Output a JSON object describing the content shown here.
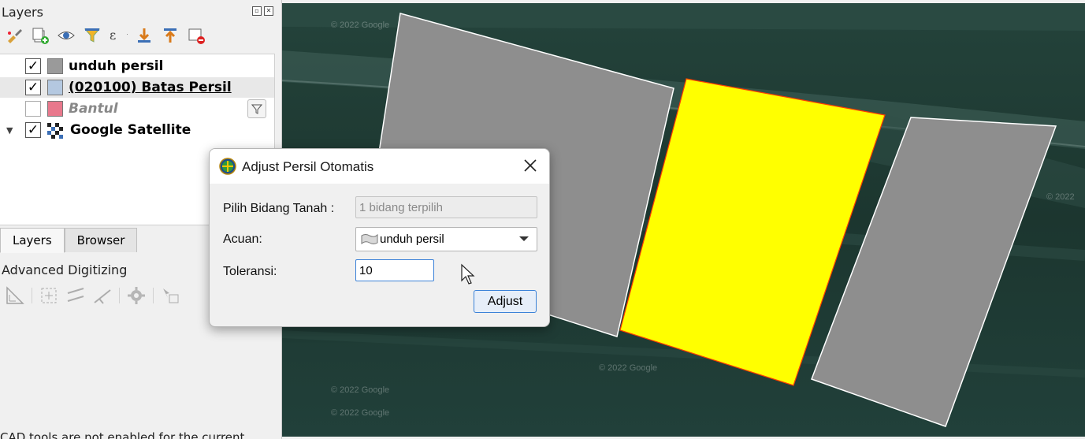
{
  "layers_panel": {
    "title": "Layers",
    "toolbar_icons": [
      "style-brush-icon",
      "add-group-icon",
      "eye-icon",
      "filter-icon",
      "expression-filter-icon",
      "expand-all-icon",
      "collapse-all-icon",
      "remove-layer-icon"
    ],
    "layers": [
      {
        "name": "unduh persil",
        "checked": true,
        "symbol_color": "#9a9a9a"
      },
      {
        "name": "(020100) Batas Persil",
        "checked": true,
        "symbol_color": "#b4c8e0",
        "selected": true
      },
      {
        "name": "Bantul",
        "checked": false,
        "symbol_color": "#e8788c"
      },
      {
        "name": "Google Satellite",
        "checked": true,
        "symbol": "raster-icon"
      }
    ]
  },
  "tabs": [
    {
      "label": "Layers",
      "active": true
    },
    {
      "label": "Browser",
      "active": false
    }
  ],
  "advanced_digitizing": {
    "title": "Advanced Digitizing"
  },
  "status_text": "CAD tools are not enabled for the current",
  "map": {
    "watermark": "© 2022 Google",
    "colors": {
      "background": "#1f3a34",
      "parcel_gray": "#8e8e8e",
      "parcel_selected": "#ffff00",
      "outline": "#ffffff",
      "selected_outline": "#ff3b00"
    }
  },
  "dialog": {
    "title": "Adjust Persil Otomatis",
    "pilih_label": "Pilih Bidang Tanah :",
    "pilih_value": "1 bidang terpilih",
    "acuan_label": "Acuan:",
    "acuan_value": "unduh persil",
    "toleransi_label": "Toleransi:",
    "toleransi_value": "10",
    "adjust_button": "Adjust"
  }
}
